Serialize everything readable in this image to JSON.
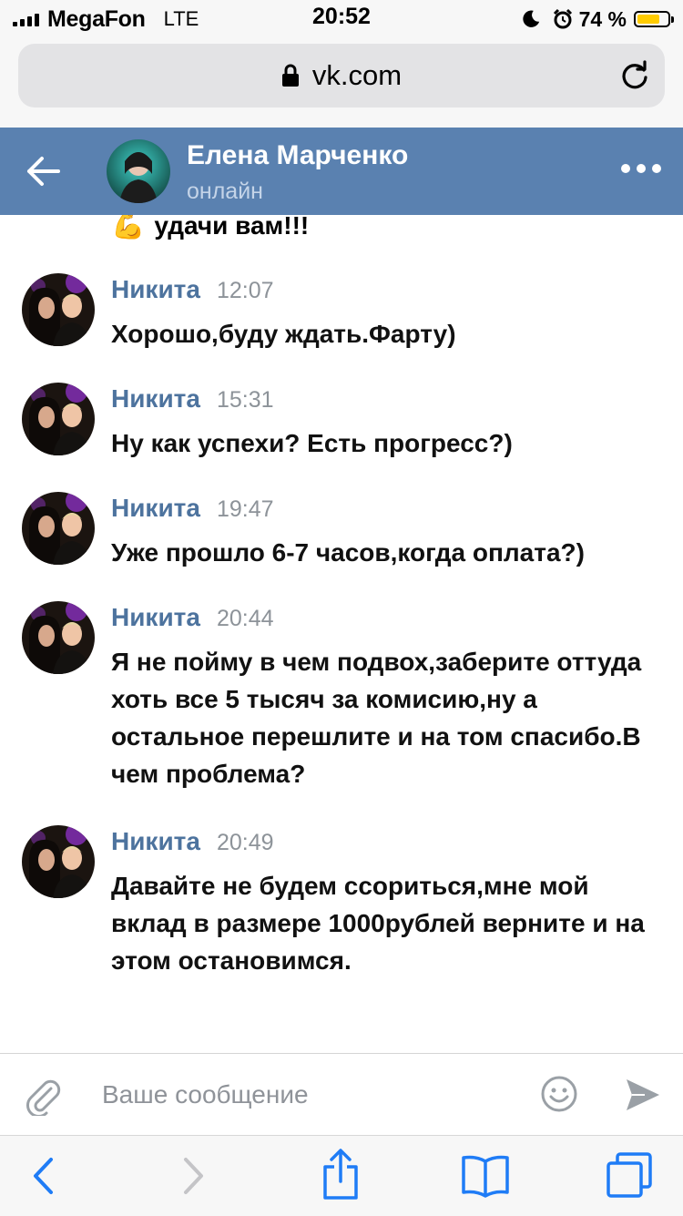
{
  "status_bar": {
    "carrier": "MegaFon",
    "network": "LTE",
    "time": "20:52",
    "battery_percent": "74 %",
    "battery_level": 0.74
  },
  "browser": {
    "url": "vk.com"
  },
  "chat_header": {
    "name": "Елена Марченко",
    "status": "онлайн"
  },
  "previous_message_tail": {
    "emoji": "💪",
    "text": "удачи вам!!!"
  },
  "messages": [
    {
      "author": "Никита",
      "time": "12:07",
      "text": "Хорошо,буду ждать.Фарту)"
    },
    {
      "author": "Никита",
      "time": "15:31",
      "text": "Ну как успехи? Есть прогресс?)"
    },
    {
      "author": "Никита",
      "time": "19:47",
      "text": "Уже прошло 6-7 часов,когда оплата?)"
    },
    {
      "author": "Никита",
      "time": "20:44",
      "text": "Я не пойму в чем подвох,заберите оттуда хоть все 5 тысяч за комисию,ну а остальное перешлите и на том спасибо.В чем проблема?"
    },
    {
      "author": "Никита",
      "time": "20:49",
      "text": "Давайте не будем ссориться,мне мой вклад в размере 1000рублей верните и на этом остановимся."
    }
  ],
  "composer": {
    "placeholder": "Ваше сообщение"
  },
  "icons": {
    "status": [
      "signal-icon",
      "moon-icon",
      "alarm-icon",
      "battery-icon"
    ],
    "browser": [
      "lock-icon",
      "reload-icon"
    ],
    "header": [
      "back-arrow-icon",
      "more-dots-icon"
    ],
    "composer": [
      "paperclip-icon",
      "smile-icon",
      "send-icon"
    ],
    "toolbar": [
      "back-icon",
      "forward-icon",
      "share-icon",
      "bookmarks-icon",
      "tabs-icon"
    ]
  },
  "colors": {
    "header_bg": "#5a81b0",
    "author": "#4d739e",
    "ios_blue": "#1f7cf6",
    "battery_fill": "#ffcc00"
  }
}
